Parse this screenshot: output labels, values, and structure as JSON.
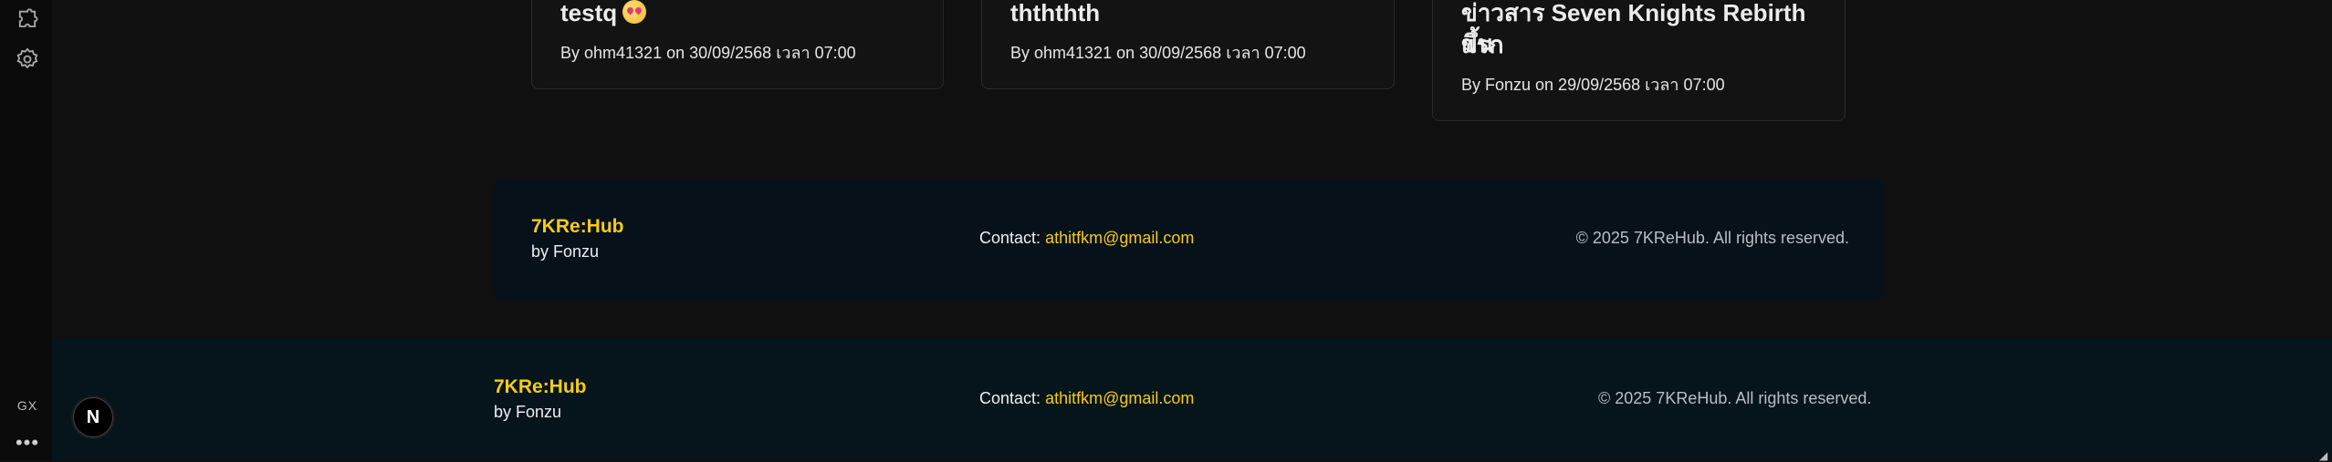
{
  "sidebar": {
    "extensions_icon": "puzzle-icon",
    "settings_icon": "gear-icon",
    "gx_label": "GX",
    "more_label": "•••"
  },
  "news_cards": [
    {
      "title": "testq",
      "meta": "By ohm41321 on 30/09/2568 เวลา 07:00"
    },
    {
      "title": "thththth",
      "meta": "By ohm41321 on 30/09/2568 เวลา 07:00"
    },
    {
      "title_line1": "ข่าวสาร Seven Knights Rebirth ขึ้น",
      "title_line2": "แรก",
      "meta": "By Fonzu on 29/09/2568 เวลา 07:00"
    }
  ],
  "footer_inner": {
    "brand": "7KRe:Hub",
    "byline": "by Fonzu",
    "contact_label": "Contact:",
    "email": "athitfkm@gmail.com",
    "copyright": "© 2025 7KReHub. All rights reserved."
  },
  "footer_outer": {
    "brand": "7KRe:Hub",
    "byline": "by Fonzu",
    "contact_label": "Contact:",
    "email": "athitfkm@gmail.com",
    "copyright": "© 2025 7KReHub. All rights reserved."
  },
  "next_badge": "N",
  "colors": {
    "accent": "#f5cc15",
    "background": "#101010",
    "footer": "#06141c"
  }
}
